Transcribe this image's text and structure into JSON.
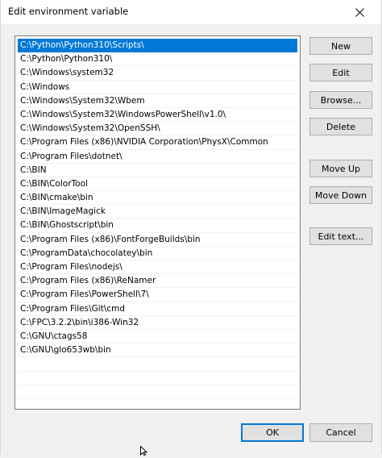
{
  "window": {
    "title": "Edit environment variable"
  },
  "paths": [
    "C:\\Python\\Python310\\Scripts\\",
    "C:\\Python\\Python310\\",
    "C:\\Windows\\system32",
    "C:\\Windows",
    "C:\\Windows\\System32\\Wbem",
    "C:\\Windows\\System32\\WindowsPowerShell\\v1.0\\",
    "C:\\Windows\\System32\\OpenSSH\\",
    "C:\\Program Files (x86)\\NVIDIA Corporation\\PhysX\\Common",
    "C:\\Program Files\\dotnet\\",
    "C:\\BIN",
    "C:\\BIN\\ColorTool",
    "C:\\BIN\\cmake\\bin",
    "C:\\BIN\\ImageMagick",
    "C:\\BIN\\Ghostscript\\bin",
    "C:\\Program Files (x86)\\FontForgeBuilds\\bin",
    "C:\\ProgramData\\chocolatey\\bin",
    "C:\\Program Files\\nodejs\\",
    "C:\\Program Files (x86)\\ReNamer",
    "C:\\Program Files\\PowerShell\\7\\",
    "C:\\Program Files\\Git\\cmd",
    "C:\\FPC\\3.2.2\\bin\\i386-Win32",
    "C:\\GNU\\ctags58",
    "C:\\GNU\\glo653wb\\bin"
  ],
  "selected_index": 0,
  "buttons": {
    "new": "New",
    "edit": "Edit",
    "browse": "Browse...",
    "delete": "Delete",
    "move_up": "Move Up",
    "move_down": "Move Down",
    "edit_text": "Edit text...",
    "ok": "OK",
    "cancel": "Cancel"
  },
  "colors": {
    "selection": "#0078d7",
    "background": "#f0f0f0"
  }
}
